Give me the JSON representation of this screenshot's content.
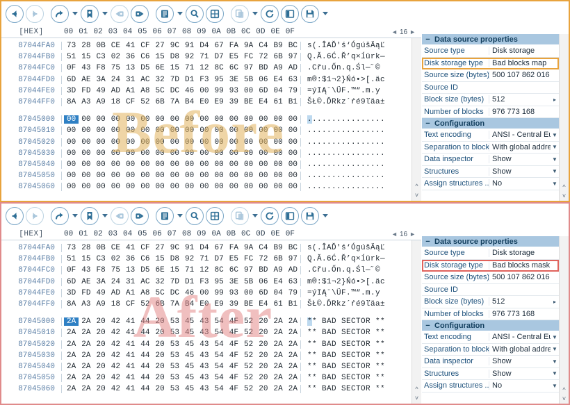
{
  "toolbar": {
    "buttons": [
      {
        "name": "back-button",
        "icon": "arrow-left-icon",
        "state": "enabled",
        "caret": false
      },
      {
        "name": "forward-button",
        "icon": "arrow-right-icon",
        "state": "disabled",
        "caret": false
      },
      {
        "name": "go-to-button",
        "icon": "arrow-curve-right-icon",
        "state": "enabled",
        "caret": true
      },
      {
        "name": "bookmark-button",
        "icon": "bookmark-icon",
        "state": "enabled",
        "caret": true
      },
      {
        "name": "previous-block-button",
        "icon": "prev-block-icon",
        "state": "disabled",
        "caret": false
      },
      {
        "name": "next-block-button",
        "icon": "next-block-icon",
        "state": "enabled",
        "caret": false
      },
      {
        "name": "list-view-button",
        "icon": "list-icon",
        "state": "enabled",
        "caret": true
      },
      {
        "name": "search-button",
        "icon": "magnifier-icon",
        "state": "enabled",
        "caret": false
      },
      {
        "name": "table-view-button",
        "icon": "grid-icon",
        "state": "enabled",
        "caret": false
      },
      {
        "name": "copy-button",
        "icon": "copy-icon",
        "state": "disabled",
        "caret": true
      },
      {
        "name": "refresh-button",
        "icon": "refresh-icon",
        "state": "enabled",
        "caret": false
      },
      {
        "name": "split-view-button",
        "icon": "book-icon",
        "state": "enabled",
        "caret": false
      },
      {
        "name": "save-button",
        "icon": "floppy-disk-icon",
        "state": "enabled",
        "caret": true
      }
    ]
  },
  "hex": {
    "label": "[HEX]",
    "columns": [
      "00",
      "01",
      "02",
      "03",
      "04",
      "05",
      "06",
      "07",
      "08",
      "09",
      "0A",
      "0B",
      "0C",
      "0D",
      "0E",
      "0F"
    ],
    "bytes_per_row": "16",
    "spin_left": "◄",
    "spin_right": "►"
  },
  "before": {
    "watermark": "Before",
    "rows": [
      {
        "addr": "87044FA0",
        "bytes": [
          "73",
          "28",
          "0B",
          "CE",
          "41",
          "CF",
          "27",
          "9C",
          "91",
          "D4",
          "67",
          "FA",
          "9A",
          "C4",
          "B9",
          "BC"
        ],
        "ascii": "s(.ÎAĎ'ś‘ÓgúšÄąĽ"
      },
      {
        "addr": "87044FB0",
        "bytes": [
          "51",
          "15",
          "C3",
          "02",
          "36",
          "C6",
          "15",
          "D8",
          "92",
          "71",
          "D7",
          "E5",
          "FC",
          "72",
          "6B",
          "97"
        ],
        "ascii": "Q.Ă.6Ć.Ř’q×ĺürk—"
      },
      {
        "addr": "87044FC0",
        "bytes": [
          "0F",
          "43",
          "F8",
          "75",
          "13",
          "D5",
          "6E",
          "15",
          "71",
          "12",
          "8C",
          "6C",
          "97",
          "BD",
          "A9",
          "AD"
        ],
        "ascii": ".Cřu.Őn.q.Śl—˝©­"
      },
      {
        "addr": "87044FD0",
        "bytes": [
          "6D",
          "AE",
          "3A",
          "24",
          "31",
          "AC",
          "32",
          "7D",
          "D1",
          "F3",
          "95",
          "3E",
          "5B",
          "06",
          "E4",
          "63"
        ],
        "ascii": "m®:$1¬2}Ńó•>[.äc"
      },
      {
        "addr": "87044FE0",
        "bytes": [
          "3D",
          "FD",
          "49",
          "AD",
          "A1",
          "A8",
          "5C",
          "DC",
          "46",
          "00",
          "99",
          "93",
          "00",
          "6D",
          "04",
          "79"
        ],
        "ascii": "=ýI­Ą¨\\ÜF.™“.m.y"
      },
      {
        "addr": "87044FF0",
        "bytes": [
          "8A",
          "A3",
          "A9",
          "18",
          "CF",
          "52",
          "6B",
          "7A",
          "B4",
          "E0",
          "E9",
          "39",
          "BE",
          "E4",
          "61",
          "B1"
        ],
        "ascii": "ŠŁ©.ĎRkz´ŕé9ľäa±"
      }
    ],
    "rows2": [
      {
        "addr": "87045000",
        "bytes": [
          "00",
          "00",
          "00",
          "00",
          "00",
          "00",
          "00",
          "00",
          "00",
          "00",
          "00",
          "00",
          "00",
          "00",
          "00",
          "00"
        ],
        "ascii": "................",
        "selected_byte": 0
      },
      {
        "addr": "87045010",
        "bytes": [
          "00",
          "00",
          "00",
          "00",
          "00",
          "00",
          "00",
          "00",
          "00",
          "00",
          "00",
          "00",
          "00",
          "00",
          "00",
          "00"
        ],
        "ascii": "................"
      },
      {
        "addr": "87045020",
        "bytes": [
          "00",
          "00",
          "00",
          "00",
          "00",
          "00",
          "00",
          "00",
          "00",
          "00",
          "00",
          "00",
          "00",
          "00",
          "00",
          "00"
        ],
        "ascii": "................"
      },
      {
        "addr": "87045030",
        "bytes": [
          "00",
          "00",
          "00",
          "00",
          "00",
          "00",
          "00",
          "00",
          "00",
          "00",
          "00",
          "00",
          "00",
          "00",
          "00",
          "00"
        ],
        "ascii": "................"
      },
      {
        "addr": "87045040",
        "bytes": [
          "00",
          "00",
          "00",
          "00",
          "00",
          "00",
          "00",
          "00",
          "00",
          "00",
          "00",
          "00",
          "00",
          "00",
          "00",
          "00"
        ],
        "ascii": "................"
      },
      {
        "addr": "87045050",
        "bytes": [
          "00",
          "00",
          "00",
          "00",
          "00",
          "00",
          "00",
          "00",
          "00",
          "00",
          "00",
          "00",
          "00",
          "00",
          "00",
          "00"
        ],
        "ascii": "................"
      },
      {
        "addr": "87045060",
        "bytes": [
          "00",
          "00",
          "00",
          "00",
          "00",
          "00",
          "00",
          "00",
          "00",
          "00",
          "00",
          "00",
          "00",
          "00",
          "00",
          "00"
        ],
        "ascii": "................"
      }
    ],
    "properties": {
      "section1_title": "Data source properties",
      "section1_rows": [
        {
          "key": "Source type",
          "value": "Disk storage",
          "control": "none",
          "highlight": "none"
        },
        {
          "key": "Disk storage type",
          "value": "Bad blocks map",
          "control": "none",
          "highlight": "orange"
        },
        {
          "key": "Source size (bytes)",
          "value": "500 107 862 016",
          "control": "none",
          "highlight": "none"
        },
        {
          "key": "Source ID",
          "value": "",
          "control": "none",
          "highlight": "none"
        },
        {
          "key": "Block size (bytes)",
          "value": "512",
          "control": "more",
          "highlight": "none"
        },
        {
          "key": "Number of blocks",
          "value": "976 773 168",
          "control": "none",
          "highlight": "none"
        }
      ],
      "section2_title": "Configuration",
      "section2_rows": [
        {
          "key": "Text encoding",
          "value": "ANSI - Central Eu",
          "control": "dropdown",
          "highlight": "none"
        },
        {
          "key": "Separation to blocks",
          "value": "With global addre",
          "control": "dropdown",
          "highlight": "none"
        },
        {
          "key": "Data inspector",
          "value": "Show",
          "control": "dropdown",
          "highlight": "none"
        },
        {
          "key": "Structures",
          "value": "Show",
          "control": "dropdown",
          "highlight": "none"
        },
        {
          "key": "Assign structures ...",
          "value": "No",
          "control": "dropdown",
          "highlight": "none"
        }
      ]
    }
  },
  "after": {
    "watermark": "After",
    "rows": [
      {
        "addr": "87044FA0",
        "bytes": [
          "73",
          "28",
          "0B",
          "CE",
          "41",
          "CF",
          "27",
          "9C",
          "91",
          "D4",
          "67",
          "FA",
          "9A",
          "C4",
          "B9",
          "BC"
        ],
        "ascii": "s(.ÎAĎ'ś‘ÓgúšÄąĽ"
      },
      {
        "addr": "87044FB0",
        "bytes": [
          "51",
          "15",
          "C3",
          "02",
          "36",
          "C6",
          "15",
          "D8",
          "92",
          "71",
          "D7",
          "E5",
          "FC",
          "72",
          "6B",
          "97"
        ],
        "ascii": "Q.Ă.6Ć.Ř’q×ĺürk—"
      },
      {
        "addr": "87044FC0",
        "bytes": [
          "0F",
          "43",
          "F8",
          "75",
          "13",
          "D5",
          "6E",
          "15",
          "71",
          "12",
          "8C",
          "6C",
          "97",
          "BD",
          "A9",
          "AD"
        ],
        "ascii": ".Cřu.Őn.q.Śl—˝©­"
      },
      {
        "addr": "87044FD0",
        "bytes": [
          "6D",
          "AE",
          "3A",
          "24",
          "31",
          "AC",
          "32",
          "7D",
          "D1",
          "F3",
          "95",
          "3E",
          "5B",
          "06",
          "E4",
          "63"
        ],
        "ascii": "m®:$1¬2}Ńó•>[.äc"
      },
      {
        "addr": "87044FE0",
        "bytes": [
          "3D",
          "FD",
          "49",
          "AD",
          "A1",
          "A8",
          "5C",
          "DC",
          "46",
          "00",
          "99",
          "93",
          "00",
          "6D",
          "04",
          "79"
        ],
        "ascii": "=ýI­Ą¨\\ÜF.™“.m.y"
      },
      {
        "addr": "87044FF0",
        "bytes": [
          "8A",
          "A3",
          "A9",
          "18",
          "CF",
          "52",
          "6B",
          "7A",
          "B4",
          "E0",
          "E9",
          "39",
          "BE",
          "E4",
          "61",
          "B1"
        ],
        "ascii": "ŠŁ©.ĎRkz´ŕé9ľäa±"
      }
    ],
    "rows2": [
      {
        "addr": "87045000",
        "bytes": [
          "2A",
          "2A",
          "20",
          "42",
          "41",
          "44",
          "20",
          "53",
          "45",
          "43",
          "54",
          "4F",
          "52",
          "20",
          "2A",
          "2A"
        ],
        "ascii": "** BAD SECTOR **",
        "selected_byte": 0
      },
      {
        "addr": "87045010",
        "bytes": [
          "2A",
          "2A",
          "20",
          "42",
          "41",
          "44",
          "20",
          "53",
          "45",
          "43",
          "54",
          "4F",
          "52",
          "20",
          "2A",
          "2A"
        ],
        "ascii": "** BAD SECTOR **"
      },
      {
        "addr": "87045020",
        "bytes": [
          "2A",
          "2A",
          "20",
          "42",
          "41",
          "44",
          "20",
          "53",
          "45",
          "43",
          "54",
          "4F",
          "52",
          "20",
          "2A",
          "2A"
        ],
        "ascii": "** BAD SECTOR **"
      },
      {
        "addr": "87045030",
        "bytes": [
          "2A",
          "2A",
          "20",
          "42",
          "41",
          "44",
          "20",
          "53",
          "45",
          "43",
          "54",
          "4F",
          "52",
          "20",
          "2A",
          "2A"
        ],
        "ascii": "** BAD SECTOR **"
      },
      {
        "addr": "87045040",
        "bytes": [
          "2A",
          "2A",
          "20",
          "42",
          "41",
          "44",
          "20",
          "53",
          "45",
          "43",
          "54",
          "4F",
          "52",
          "20",
          "2A",
          "2A"
        ],
        "ascii": "** BAD SECTOR **"
      },
      {
        "addr": "87045050",
        "bytes": [
          "2A",
          "2A",
          "20",
          "42",
          "41",
          "44",
          "20",
          "53",
          "45",
          "43",
          "54",
          "4F",
          "52",
          "20",
          "2A",
          "2A"
        ],
        "ascii": "** BAD SECTOR **"
      },
      {
        "addr": "87045060",
        "bytes": [
          "2A",
          "2A",
          "20",
          "42",
          "41",
          "44",
          "20",
          "53",
          "45",
          "43",
          "54",
          "4F",
          "52",
          "20",
          "2A",
          "2A"
        ],
        "ascii": "** BAD SECTOR **"
      }
    ],
    "properties": {
      "section1_title": "Data source properties",
      "section1_rows": [
        {
          "key": "Source type",
          "value": "Disk storage",
          "control": "none",
          "highlight": "none"
        },
        {
          "key": "Disk storage type",
          "value": "Bad blocks mask",
          "control": "none",
          "highlight": "red"
        },
        {
          "key": "Source size (bytes)",
          "value": "500 107 862 016",
          "control": "none",
          "highlight": "none"
        },
        {
          "key": "Source ID",
          "value": "",
          "control": "none",
          "highlight": "none"
        },
        {
          "key": "Block size (bytes)",
          "value": "512",
          "control": "more",
          "highlight": "none"
        },
        {
          "key": "Number of blocks",
          "value": "976 773 168",
          "control": "none",
          "highlight": "none"
        }
      ],
      "section2_title": "Configuration",
      "section2_rows": [
        {
          "key": "Text encoding",
          "value": "ANSI - Central Eu",
          "control": "dropdown",
          "highlight": "none"
        },
        {
          "key": "Separation to blocks",
          "value": "With global addre",
          "control": "dropdown",
          "highlight": "none"
        },
        {
          "key": "Data inspector",
          "value": "Show",
          "control": "dropdown",
          "highlight": "none"
        },
        {
          "key": "Structures",
          "value": "Show",
          "control": "dropdown",
          "highlight": "none"
        },
        {
          "key": "Assign structures ...",
          "value": "No",
          "control": "dropdown",
          "highlight": "none"
        }
      ]
    }
  },
  "colors": {
    "before_border": "#e8a33d",
    "after_border": "#e08b8b",
    "section_header": "#a9c7e0",
    "selection": "#2f80c4",
    "address": "#5b7fa6"
  }
}
